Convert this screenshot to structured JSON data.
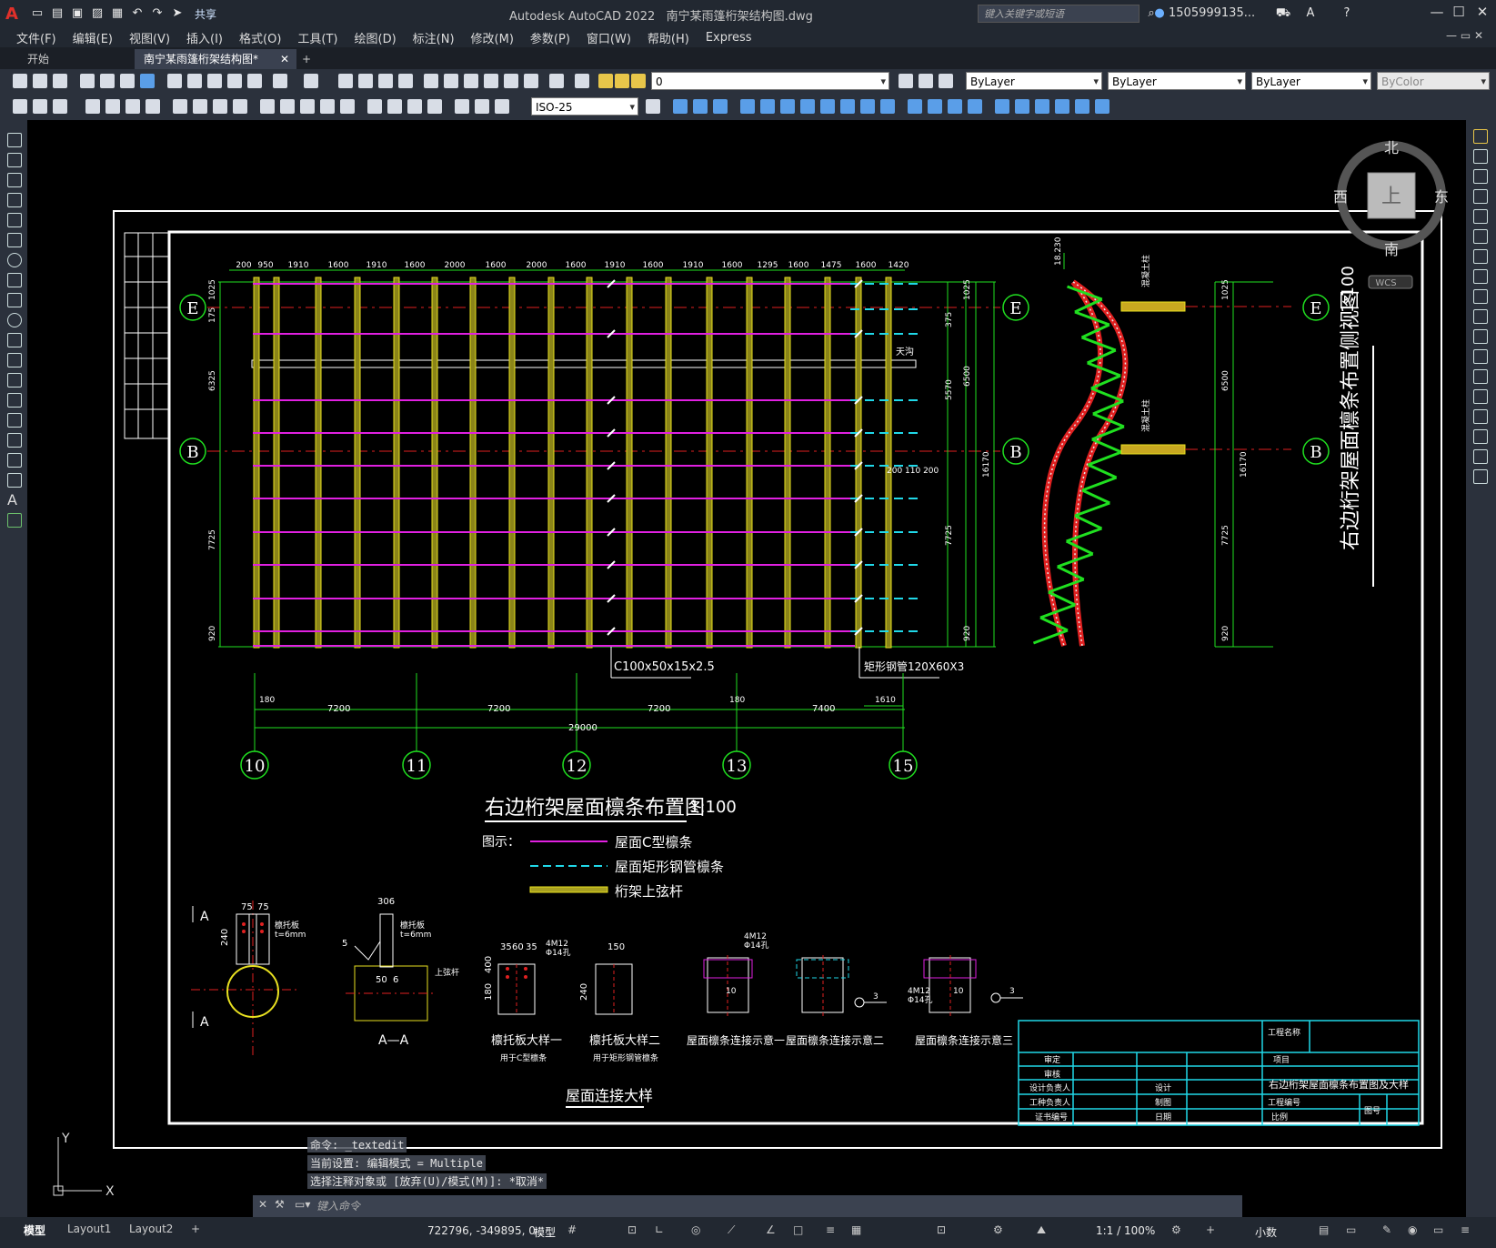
{
  "app": {
    "logo": "A",
    "title": "Autodesk AutoCAD 2022",
    "filename": "南宁某雨篷桁架结构图.dwg",
    "share": "共享",
    "search_placeholder": "键入关键字或短语",
    "user": "1505999135..."
  },
  "menu": [
    "文件(F)",
    "编辑(E)",
    "视图(V)",
    "插入(I)",
    "格式(O)",
    "工具(T)",
    "绘图(D)",
    "标注(N)",
    "修改(M)",
    "参数(P)",
    "窗口(W)",
    "帮助(H)",
    "Express"
  ],
  "tabs": {
    "start": "开始",
    "drawing": "南宁某雨篷桁架结构图*",
    "add": "+"
  },
  "toolbar": {
    "layer": "0",
    "color": "ByLayer",
    "linetype": "ByLayer",
    "lineweight": "ByLayer",
    "plotstyle": "ByColor",
    "dimstyle": "ISO-25"
  },
  "viewcube": {
    "north": "北",
    "south": "南",
    "east": "东",
    "west": "西",
    "top": "上",
    "wcs": "WCS"
  },
  "drawing": {
    "plan_title": "右边桁架屋面檩条布置图",
    "plan_scale": "1:100",
    "side_title": "右边桁架屋面檩条布置侧视图",
    "side_scale": "1:100",
    "legend_title": "图示：",
    "legend": [
      "屋面C型檩条",
      "屋面矩形钢管檩条",
      "桁架上弦杆"
    ],
    "axes_rows": [
      "E",
      "B"
    ],
    "axes_cols": [
      "10",
      "11",
      "12",
      "13",
      "15"
    ],
    "top_dims": [
      "200",
      "950",
      "1910",
      "1600",
      "1910",
      "1600",
      "2000",
      "1600",
      "2000",
      "1600",
      "1910",
      "1600",
      "1910",
      "1600",
      "1295",
      "1600",
      "1475",
      "1600",
      "1420"
    ],
    "bottom_dims": [
      "7200",
      "7200",
      "7200",
      "7400"
    ],
    "total_dim": "29000",
    "dim_180": "180",
    "dim_1610": "1610",
    "dim_200_110_200": "200 110 200",
    "left_dims": [
      "1025",
      "175",
      "6325",
      "7725",
      "920"
    ],
    "right_dims": [
      "1025",
      "375",
      "5570",
      "6500",
      "16170",
      "7725",
      "920"
    ],
    "label_c": "C100x50x15x2.5",
    "label_rect": "矩形钢管120X60X3",
    "label_gutter": "天沟",
    "section_label": "A—A",
    "detail_labels": [
      "檩托板大样一",
      "檩托板大样二",
      "屋面檩条连接示意一",
      "屋面檩条连接示意二",
      "屋面檩条连接示意三"
    ],
    "detail_sub": [
      "用于C型檩条",
      "用于矩形钢管檩条"
    ],
    "detail_group": "屋面连接大样",
    "detail_dims": [
      "75",
      "75",
      "240",
      "306",
      "5",
      "50",
      "6",
      "35",
      "60",
      "35",
      "4M12",
      "Φ14孔",
      "150",
      "180",
      "400",
      "240",
      "10",
      "3"
    ],
    "plate_notes": [
      "檩托板",
      "t=6mm",
      "檩托板",
      "t=6mm",
      "上弦杆"
    ],
    "section_marks": [
      "A",
      "A"
    ],
    "side_notes": [
      "混凝土柱",
      "混凝土柱"
    ],
    "side_dim_top": "18.230"
  },
  "titleblock": {
    "rows": [
      "审定",
      "审核",
      "设计负责人",
      "工种负责人",
      "证书编号"
    ],
    "col2": [
      "设计",
      "制图",
      "日期"
    ],
    "project_label": "工程名称",
    "item_label": "项目",
    "drawing_name": "右边桁架屋面檩条布置图及大样",
    "number_label": "工程编号",
    "scale_label": "比例",
    "sheet_label": "图号"
  },
  "command": {
    "history": [
      "命令: _textedit",
      "当前设置: 编辑模式 = Multiple",
      "选择注释对象或 [放弃(U)/模式(M)]: *取消*"
    ],
    "placeholder": "键入命令"
  },
  "status": {
    "tabs": [
      "模型",
      "Layout1",
      "Layout2",
      "+"
    ],
    "coords": "722796, -349895, 0",
    "mode": "模型",
    "scale": "1:1 / 100%",
    "units": "小数"
  },
  "ucs": {
    "x": "X",
    "y": "Y"
  },
  "colors": {
    "magenta": "#e020e0",
    "cyan": "#20d8e8",
    "yellow": "#e8e020",
    "green": "#20e020",
    "red": "#e02020",
    "white": "#ffffff"
  }
}
